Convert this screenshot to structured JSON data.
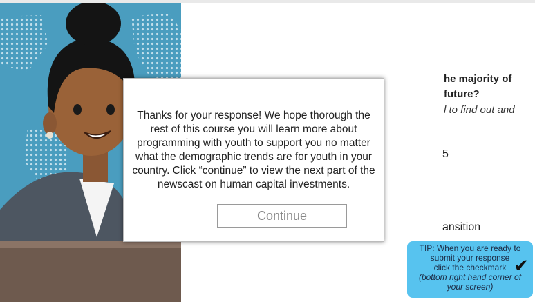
{
  "question": {
    "line1": "he majority of",
    "line2": "future?",
    "line3": "l to find out and",
    "fragment_5": "5",
    "fragment_transition": "ansition"
  },
  "tip": {
    "line1": "TIP: When you are ready to",
    "line2": "submit your response",
    "line3": "click the checkmark",
    "line4": "(bottom right hand corner of",
    "line5": "your screen)"
  },
  "modal": {
    "message": "Thanks for your response! We hope thorough the rest of this course you will learn more about programming with youth to support you no matter what the demographic trends are for youth in your country. Click “continue” to view the next part of the newscast on human capital investments.",
    "continue_label": "Continue"
  },
  "colors": {
    "illustration_bg": "#4a9dbf",
    "tip_bg": "#57c3ef",
    "desk": "#6e5a4e"
  }
}
